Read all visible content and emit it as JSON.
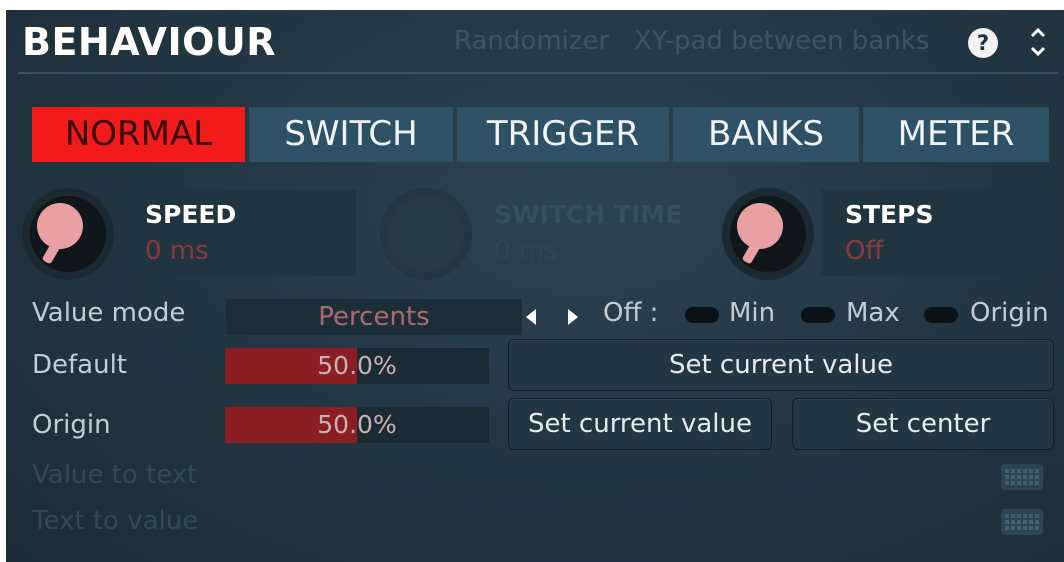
{
  "header": {
    "title": "BEHAVIOUR",
    "links": [
      "Randomizer",
      "XY-pad between banks"
    ],
    "help_glyph": "?",
    "updown_icon": "chevron-updown-icon"
  },
  "tabs": [
    {
      "label": "NORMAL",
      "active": true
    },
    {
      "label": "SWITCH",
      "active": false
    },
    {
      "label": "TRIGGER",
      "active": false
    },
    {
      "label": "BANKS",
      "active": false
    },
    {
      "label": "METER",
      "active": false
    }
  ],
  "knobs": [
    {
      "label": "SPEED",
      "value": "0 ms",
      "enabled": true
    },
    {
      "label": "SWITCH TIME",
      "value": "0 ms",
      "enabled": false
    },
    {
      "label": "STEPS",
      "value": "Off",
      "enabled": true
    }
  ],
  "value_mode": {
    "label": "Value mode",
    "selected": "Percents",
    "off_label": "Off :",
    "options": [
      "Min",
      "Max",
      "Origin"
    ]
  },
  "default": {
    "label": "Default",
    "value_text": "50.0%",
    "fraction": 0.5,
    "button": "Set current value"
  },
  "origin": {
    "label": "Origin",
    "value_text": "50.0%",
    "fraction": 0.5,
    "buttons": [
      "Set current value",
      "Set center"
    ]
  },
  "disabled_rows": [
    {
      "label": "Value to text",
      "icon": "keyboard-icon"
    },
    {
      "label": "Text to value",
      "icon": "keyboard-icon"
    }
  ],
  "colors": {
    "accent_active_tab": "#f11b1b",
    "tab_bg": "#2f5165",
    "slider_fill": "#8a1e24",
    "knob_face": "#e8a0a2"
  }
}
